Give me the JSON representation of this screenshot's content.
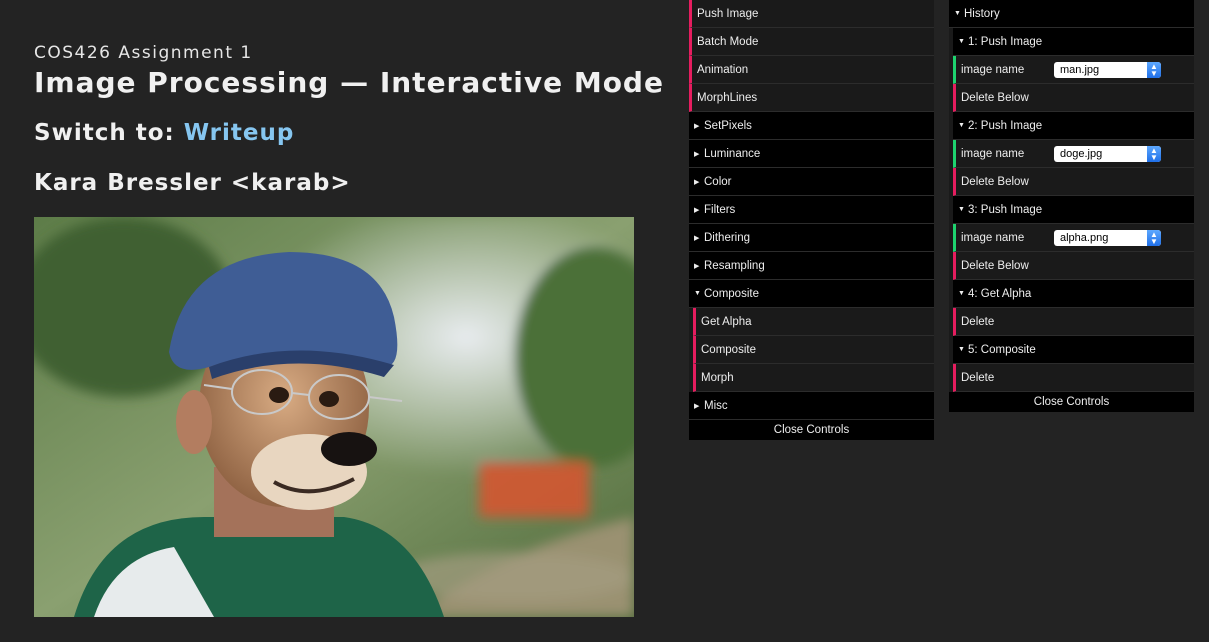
{
  "header": {
    "course": "COS426 Assignment 1",
    "title": "Image Processing — Interactive Mode",
    "switch_prefix": "Switch to: ",
    "switch_link": "Writeup",
    "author": "Kara Bressler <karab>"
  },
  "controls": {
    "items": {
      "push_image": "Push Image",
      "batch_mode": "Batch Mode",
      "animation": "Animation",
      "morphlines": "MorphLines"
    },
    "folders": {
      "setpixels": "SetPixels",
      "luminance": "Luminance",
      "color": "Color",
      "filters": "Filters",
      "dithering": "Dithering",
      "resampling": "Resampling",
      "composite": "Composite",
      "misc": "Misc"
    },
    "composite_items": {
      "get_alpha": "Get Alpha",
      "composite": "Composite",
      "morph": "Morph"
    },
    "close_label": "Close Controls"
  },
  "history": {
    "title": "History",
    "entries": [
      {
        "title": "1: Push Image",
        "param_label": "image name",
        "param_value": "man.jpg",
        "action": "Delete Below"
      },
      {
        "title": "2: Push Image",
        "param_label": "image name",
        "param_value": "doge.jpg",
        "action": "Delete Below"
      },
      {
        "title": "3: Push Image",
        "param_label": "image name",
        "param_value": "alpha.png",
        "action": "Delete Below"
      },
      {
        "title": "4: Get Alpha",
        "action": "Delete"
      },
      {
        "title": "5: Composite",
        "action": "Delete"
      }
    ],
    "close_label": "Close Controls"
  },
  "colors": {
    "background": "#232323",
    "function_accent": "#e61d5f",
    "parameter_accent": "#1ed36f",
    "link": "#86c6f0"
  },
  "icons": {
    "folder_open": "triangle-down-icon",
    "folder_closed": "triangle-right-icon",
    "select": "select-arrows-icon"
  }
}
